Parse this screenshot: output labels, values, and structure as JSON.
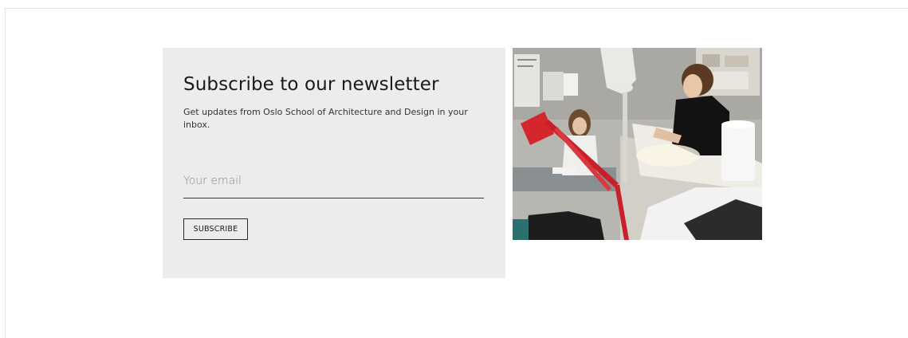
{
  "newsletter": {
    "title": "Subscribe to our newsletter",
    "description": "Get updates from Oslo School of Architecture and Design in your inbox.",
    "email_placeholder": "Your email",
    "email_value": "",
    "subscribe_label": "SUBSCRIBE"
  },
  "photo": {
    "subject": "students drawing at desks in an architecture studio with red desk lamp"
  },
  "colors": {
    "panel_bg": "#ececec",
    "lamp_red": "#d4262c"
  }
}
